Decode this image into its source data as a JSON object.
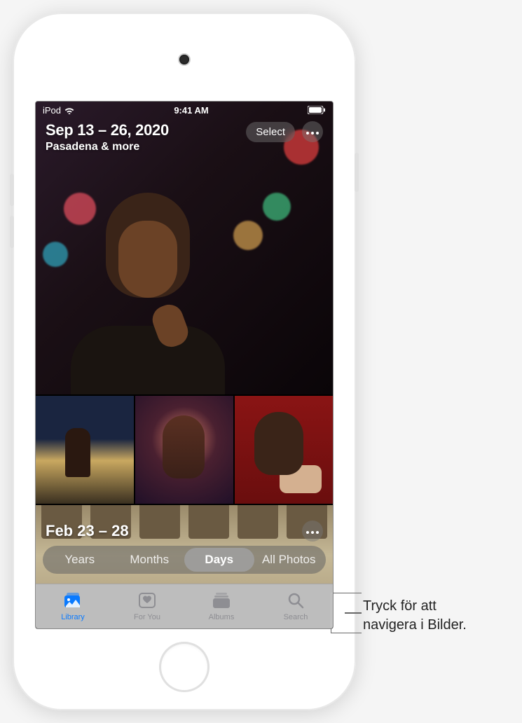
{
  "status": {
    "carrier": "iPod",
    "time": "9:41 AM"
  },
  "hero": {
    "date_range": "Sep 13 – 26, 2020",
    "location": "Pasadena & more",
    "select_label": "Select"
  },
  "section2": {
    "date_range": "Feb 23 – 28"
  },
  "view_switcher": {
    "years": "Years",
    "months": "Months",
    "days": "Days",
    "all": "All Photos",
    "active": "days"
  },
  "tabs": {
    "library": "Library",
    "for_you": "For You",
    "albums": "Albums",
    "search": "Search",
    "active": "library"
  },
  "callout": {
    "line1": "Tryck för att",
    "line2": "navigera i Bilder."
  }
}
